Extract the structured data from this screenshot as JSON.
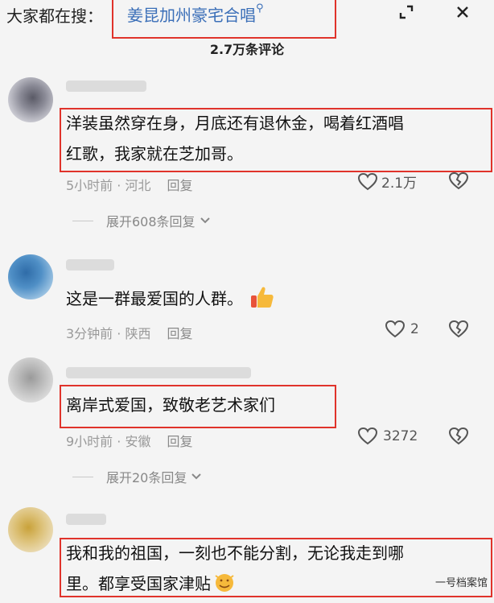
{
  "header": {
    "prefix": "大家都在搜：",
    "search_term": "姜昆加州豪宅合唱",
    "comment_count": "2.7万条评论"
  },
  "comments": [
    {
      "text_line1": "洋装虽然穿在身，月底还有退休金，喝着红酒唱",
      "text_line2": "红歌，我家就在芝加哥。",
      "time": "5小时前",
      "location": "河北",
      "reply": "回复",
      "likes": "2.1万",
      "expand": "展开608条回复"
    },
    {
      "text_line1": "这是一群最爱国的人群。",
      "time": "3分钟前",
      "location": "陕西",
      "reply": "回复",
      "likes": "2"
    },
    {
      "text_line1": "离岸式爱国，致敬老艺术家们",
      "time": "9小时前",
      "location": "安徽",
      "reply": "回复",
      "likes": "3272",
      "expand": "展开20条回复"
    },
    {
      "text_line1": "我和我的祖国，一刻也不能分割，无论我走到哪",
      "text_line2": "里。都享受国家津贴"
    }
  ],
  "watermark": "一号档案馆",
  "colors": {
    "highlight_box": "#e0332b",
    "search_term": "#3b6fb8"
  }
}
